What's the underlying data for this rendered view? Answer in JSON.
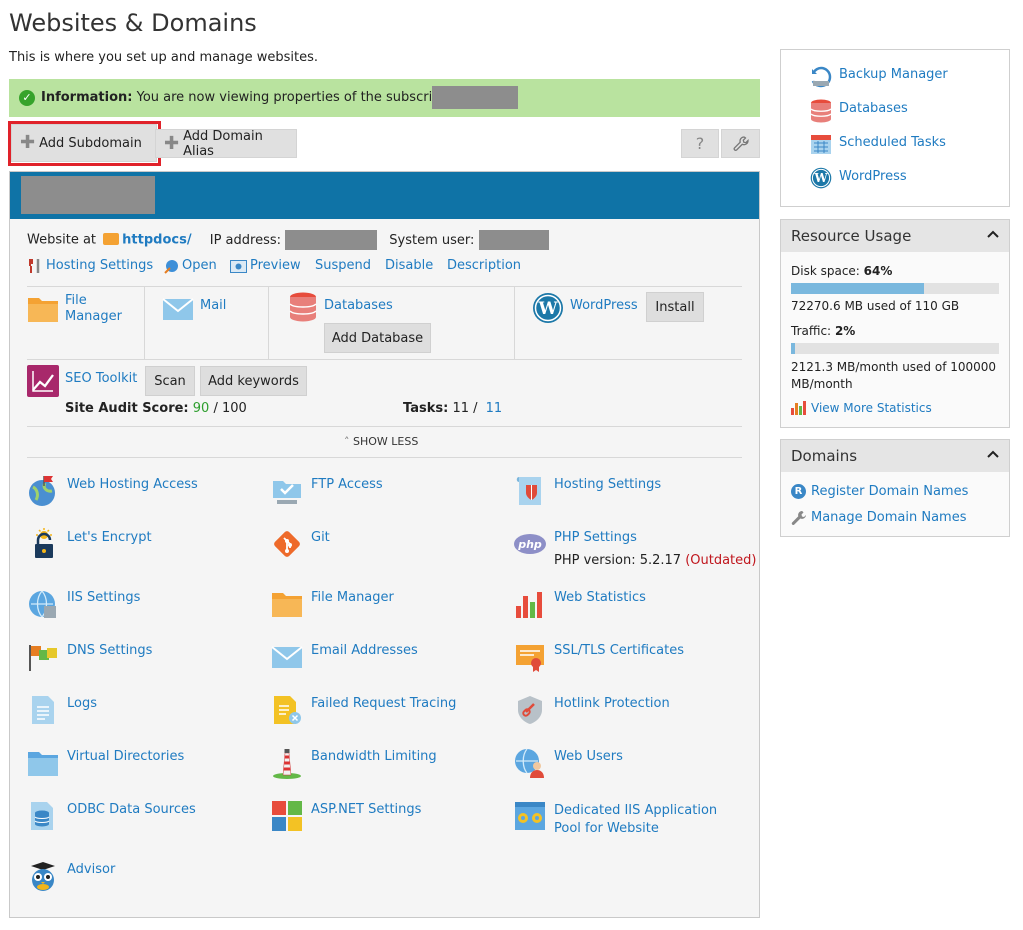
{
  "page": {
    "title": "Websites & Domains",
    "description": "This is where you set up and manage websites."
  },
  "info": {
    "label": "Information:",
    "message": "You are now viewing properties of the subscription"
  },
  "toolbar": {
    "add_subdomain": "Add Subdomain",
    "add_domain_alias": "Add Domain Alias",
    "help": "?"
  },
  "domain": {
    "website_at_label": "Website at",
    "httpdocs": "httpdocs/",
    "ip_label": "IP address:",
    "system_user_label": "System user:",
    "actions": [
      "Hosting Settings",
      "Open",
      "Preview",
      "Suspend",
      "Disable",
      "Description"
    ]
  },
  "quick": {
    "file_manager": "File Manager",
    "mail": "Mail",
    "databases": "Databases",
    "add_database": "Add Database",
    "wordpress": "WordPress",
    "install": "Install",
    "seo_toolkit": "SEO Toolkit",
    "scan": "Scan",
    "add_keywords": "Add keywords",
    "site_audit_label": "Site Audit Score:",
    "site_audit_score": "90",
    "site_audit_total": "/ 100",
    "tasks_label": "Tasks:",
    "tasks_done": "11 /",
    "tasks_total": "11",
    "show_less": "SHOW LESS"
  },
  "tools": [
    {
      "label": "Web Hosting Access",
      "icon": "globe-flag-icon"
    },
    {
      "label": "FTP Access",
      "icon": "ftp-folder-icon"
    },
    {
      "label": "Hosting Settings",
      "icon": "hosting-settings-icon"
    },
    {
      "label": "Let's Encrypt",
      "icon": "lock-sun-icon"
    },
    {
      "label": "Git",
      "icon": "git-icon"
    },
    {
      "label": "PHP Settings",
      "icon": "php-icon"
    },
    {
      "label": "IIS Settings",
      "icon": "iis-globe-icon"
    },
    {
      "label": "File Manager",
      "icon": "folder-icon"
    },
    {
      "label": "Web Statistics",
      "icon": "bar-chart-icon"
    },
    {
      "label": "DNS Settings",
      "icon": "dns-flags-icon"
    },
    {
      "label": "Email Addresses",
      "icon": "envelope-icon"
    },
    {
      "label": "SSL/TLS Certificates",
      "icon": "certificate-icon"
    },
    {
      "label": "Logs",
      "icon": "log-file-icon"
    },
    {
      "label": "Failed Request Tracing",
      "icon": "trace-file-icon"
    },
    {
      "label": "Hotlink Protection",
      "icon": "shield-link-icon"
    },
    {
      "label": "Virtual Directories",
      "icon": "directory-folder-icon"
    },
    {
      "label": "Bandwidth Limiting",
      "icon": "lighthouse-icon"
    },
    {
      "label": "Web Users",
      "icon": "web-users-icon"
    },
    {
      "label": "ODBC Data Sources",
      "icon": "database-doc-icon"
    },
    {
      "label": "ASP.NET Settings",
      "icon": "windows-tiles-icon"
    },
    {
      "label": "Dedicated IIS Application Pool for Website",
      "icon": "app-pool-icon"
    },
    {
      "label": "Advisor",
      "icon": "owl-icon"
    }
  ],
  "php": {
    "version_label": "PHP version: 5.2.17",
    "status": "(Outdated)"
  },
  "sidebar": {
    "links": [
      "Backup Manager",
      "Databases",
      "Scheduled Tasks",
      "WordPress"
    ],
    "resource_usage": {
      "title": "Resource Usage",
      "disk_label": "Disk space:",
      "disk_pct": "64%",
      "disk_fraction": 0.64,
      "disk_detail": "72270.6 MB used of 110 GB",
      "traffic_label": "Traffic:",
      "traffic_pct": "2%",
      "traffic_fraction": 0.02,
      "traffic_detail": "2121.3 MB/month used of 100000 MB/month",
      "more_stats": "View More Statistics"
    },
    "domains": {
      "title": "Domains",
      "register": "Register Domain Names",
      "manage": "Manage Domain Names"
    }
  },
  "colors": {
    "accent_blue": "#0f73a6",
    "info_green": "#b9e39f",
    "link": "#1f7bc1",
    "highlight_red": "#e0222a",
    "score_green": "#2e9e2e",
    "outdated_red": "#c0161d"
  }
}
